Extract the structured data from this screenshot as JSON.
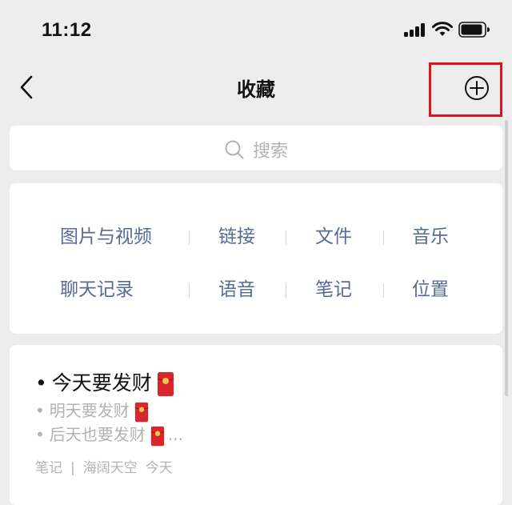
{
  "status": {
    "time": "11:12"
  },
  "nav": {
    "title": "收藏"
  },
  "search": {
    "placeholder": "搜索"
  },
  "categories": {
    "row1": [
      "图片与视频",
      "链接",
      "文件",
      "音乐"
    ],
    "row2": [
      "聊天记录",
      "语音",
      "笔记",
      "位置"
    ]
  },
  "note": {
    "line1": "今天要发财",
    "line2": "明天要发财",
    "line3": "后天也要发财",
    "line3_suffix": "...",
    "type": "笔记",
    "meta_sep": "|",
    "source": "海阔天空",
    "date": "今天"
  },
  "colors": {
    "accent_link": "#576b95",
    "highlight_box": "#e0141e",
    "envelope": "#d8262c"
  },
  "icons": [
    "back-chevron-icon",
    "add-circle-icon",
    "search-icon",
    "red-envelope-icon",
    "signal-icon",
    "wifi-icon",
    "battery-icon"
  ]
}
